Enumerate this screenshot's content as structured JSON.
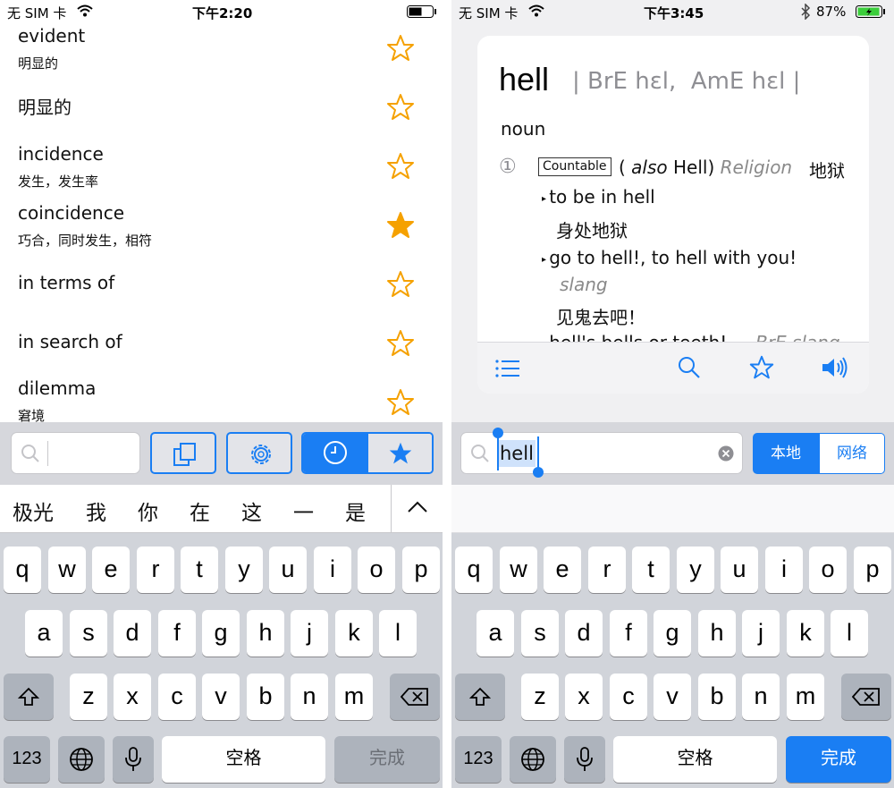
{
  "left": {
    "status": {
      "carrier": "无 SIM 卡",
      "time": "下午2:20"
    },
    "words": [
      {
        "word": "evident",
        "meaning": "明显的",
        "starred": false
      },
      {
        "word": "明显的",
        "meaning": "",
        "starred": false
      },
      {
        "word": "incidence",
        "meaning": "发生，发生率",
        "starred": false
      },
      {
        "word": "coincidence",
        "meaning": "巧合，同时发生，相符",
        "starred": true
      },
      {
        "word": "in terms of",
        "meaning": "",
        "starred": false
      },
      {
        "word": "in search of",
        "meaning": "",
        "starred": false
      },
      {
        "word": "dilemma",
        "meaning": "窘境",
        "starred": false
      }
    ],
    "search": {
      "value": ""
    },
    "candidates": [
      "极光",
      "我",
      "你",
      "在",
      "这",
      "一",
      "是"
    ],
    "keyboard": {
      "row1": [
        "q",
        "w",
        "e",
        "r",
        "t",
        "y",
        "u",
        "i",
        "o",
        "p"
      ],
      "row2": [
        "a",
        "s",
        "d",
        "f",
        "g",
        "h",
        "j",
        "k",
        "l"
      ],
      "row3": [
        "z",
        "x",
        "c",
        "v",
        "b",
        "n",
        "m"
      ],
      "num": "123",
      "space": "空格",
      "done": "完成"
    }
  },
  "right": {
    "status": {
      "carrier": "无 SIM 卡",
      "time": "下午3:45",
      "battery": "87%"
    },
    "entry": {
      "headword": "hell",
      "pron_bre": "BrE hɛl",
      "pron_ame": "AmE hɛl",
      "pos": "noun",
      "sense_num": "①",
      "countable": "Countable",
      "also_prefix": "( ",
      "also": "also",
      "also_word": " Hell) ",
      "domain": "Religion",
      "gloss": "地狱",
      "examples": [
        {
          "en": "to be in hell",
          "zh": "身处地狱",
          "tag": ""
        },
        {
          "en": "go to hell!, to hell with you!",
          "zh": "见鬼去吧！",
          "tag": "slang"
        },
        {
          "en": "hell's bells or teeth!",
          "tag2": "BrE slang"
        }
      ]
    },
    "search": {
      "value": "hell"
    },
    "segment": {
      "local": "本地",
      "net": "网络"
    },
    "keyboard": {
      "row1": [
        "q",
        "w",
        "e",
        "r",
        "t",
        "y",
        "u",
        "i",
        "o",
        "p"
      ],
      "row2": [
        "a",
        "s",
        "d",
        "f",
        "g",
        "h",
        "j",
        "k",
        "l"
      ],
      "row3": [
        "z",
        "x",
        "c",
        "v",
        "b",
        "n",
        "m"
      ],
      "num": "123",
      "space": "空格",
      "done": "完成"
    }
  },
  "colors": {
    "accent": "#1a7ef3",
    "star": "#f5a100"
  },
  "icons": [
    "star-icon",
    "copy-icon",
    "settings-icon",
    "clock-icon",
    "search-icon",
    "list-icon",
    "speaker-icon",
    "shift-icon",
    "delete-icon",
    "globe-icon",
    "mic-icon",
    "chevron-up-icon",
    "clear-icon",
    "wifi-icon",
    "battery-icon",
    "bluetooth-icon"
  ]
}
